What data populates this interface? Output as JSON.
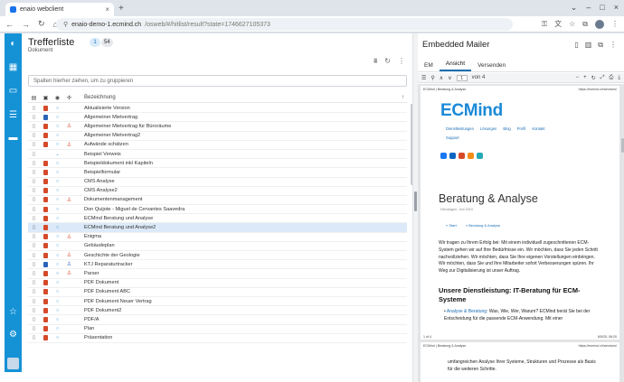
{
  "browser": {
    "tab_title": "enaio webclient",
    "url_host": "enaio-demo-1.ecmind.ch",
    "url_path": "/osweb/#/hitlist/result?state=1746627105373"
  },
  "hitlist": {
    "title": "Trefferliste",
    "count_selected": "1",
    "count_total": "54",
    "subtitle": "Dokument",
    "group_placeholder": "Spalten hierher ziehen, um zu gruppieren",
    "column_name": "Bezeichnung",
    "rows": [
      {
        "badge": "b-red",
        "status": "○",
        "cat": "",
        "name": "Aktualisierte Version"
      },
      {
        "badge": "b-blue",
        "status": "○",
        "cat": "",
        "name": "Allgemeiner Mietvertrag"
      },
      {
        "badge": "b-red",
        "status": "○",
        "cat": "♙",
        "name": "Allgemeiner Mietvertrag für Büroräume"
      },
      {
        "badge": "b-red",
        "status": "○",
        "cat": "",
        "name": "Allgemeiner Mietvertrag2"
      },
      {
        "badge": "b-red",
        "status": "○",
        "cat": "♙",
        "name": "Aufwände schätzen"
      },
      {
        "badge": "b-none",
        "status": "⌄",
        "cat": "",
        "name": "Beispiel Verweis"
      },
      {
        "badge": "b-red",
        "status": "○",
        "cat": "",
        "name": "Beispieldokument inkl Kapiteln"
      },
      {
        "badge": "b-red",
        "status": "○",
        "cat": "",
        "name": "Beispielformular"
      },
      {
        "badge": "b-red",
        "status": "○",
        "cat": "",
        "name": "CMS Analyse"
      },
      {
        "badge": "b-red",
        "status": "○",
        "cat": "",
        "name": "CMS Analyse2"
      },
      {
        "badge": "b-red",
        "status": "○",
        "cat": "♙",
        "name": "Dokumentenmanagement"
      },
      {
        "badge": "b-red",
        "status": "○",
        "cat": "",
        "name": "Don Quijote - Miguel de Cervantes Saavedra"
      },
      {
        "badge": "b-red",
        "status": "○",
        "cat": "",
        "name": "ECMind Beratung und Analyse"
      },
      {
        "badge": "b-red",
        "status": "○",
        "cat": "",
        "name": "ECMind Beratung und Analyse2"
      },
      {
        "badge": "b-red",
        "status": "○",
        "cat": "♙",
        "name": "Enigma"
      },
      {
        "badge": "b-red",
        "status": "○",
        "cat": "",
        "name": "Gebäudeplan"
      },
      {
        "badge": "b-red",
        "status": "○",
        "cat": "♙",
        "name": "Geschichte der Geologie"
      },
      {
        "badge": "b-blue",
        "status": "○",
        "cat": "♙",
        "name": "KTJ Reparaturtracker"
      },
      {
        "badge": "b-red",
        "status": "○",
        "cat": "♙",
        "name": "Parser"
      },
      {
        "badge": "b-red",
        "status": "○",
        "cat": "",
        "name": "PDF Dokument"
      },
      {
        "badge": "b-red",
        "status": "○",
        "cat": "",
        "name": "PDF Dokument ABC"
      },
      {
        "badge": "b-red",
        "status": "○",
        "cat": "",
        "name": "PDF Dokument Neuer Vertrag"
      },
      {
        "badge": "b-red",
        "status": "○",
        "cat": "",
        "name": "PDF Dokument2"
      },
      {
        "badge": "b-red",
        "status": "○",
        "cat": "",
        "name": "PDF/A"
      },
      {
        "badge": "b-red",
        "status": "○",
        "cat": "",
        "name": "Plan"
      },
      {
        "badge": "b-red",
        "status": "○",
        "cat": "",
        "name": "Präsentation"
      }
    ]
  },
  "mailer": {
    "title": "Embedded Mailer",
    "tabs": [
      "EM",
      "Ansicht",
      "Versenden"
    ],
    "page_current": "1",
    "page_of": "von 4"
  },
  "pdf": {
    "header_left": "ECMind | Beratung & Analyse",
    "header_right": "https://ecmind.ch/services/",
    "logo_ecm": "ECM",
    "logo_ind": "ind",
    "nav": [
      "Dienstleistungen",
      "Lösungen",
      "Blog",
      "Profil",
      "Kontakt"
    ],
    "support": "Support",
    "title": "Beratung & Analyse",
    "date": "Dienstagen, Juni 2024",
    "crumbs": [
      "» Start",
      "» Beratung & Analyse"
    ],
    "intro": "Wir tragen zu Ihrem Erfolg bei: Mit einem individuell zugeschnittenen ECM-System gehen wir auf Ihre Bedürfnisse ein. Wir möchten, dass Sie jeden Schritt nachvollziehen. Wir möchten, dass Sie Ihre eigenen Vorstellungen einbringen. Wir möchten, dass Sie und Ihre Mitarbeiter sofort Verbesserungen spüren. Ihr Weg zur Digitalisierung ist unser Auftrag.",
    "subheading": "Unsere Dienstleistung: IT-Beratung für ECM-Systeme",
    "bullet_link": "Analyse & Beratung",
    "bullet_text": ": Was, Wie, Wer, Warum? ECMind berät Sie bei der Entscheidung für die passende ECM-Anwendung. Mit einer",
    "footer_left": "1 of 4",
    "footer_right": "6/5/25, 06:20",
    "page2_header_left": "ECMind | Beratung & Analyse",
    "page2_header_right": "https://ecmind.ch/services/",
    "page2_text": "umfangreichen Analyse Ihrer Systeme, Strukturen und Prozesse als Basis für die weiteren Schritte."
  }
}
